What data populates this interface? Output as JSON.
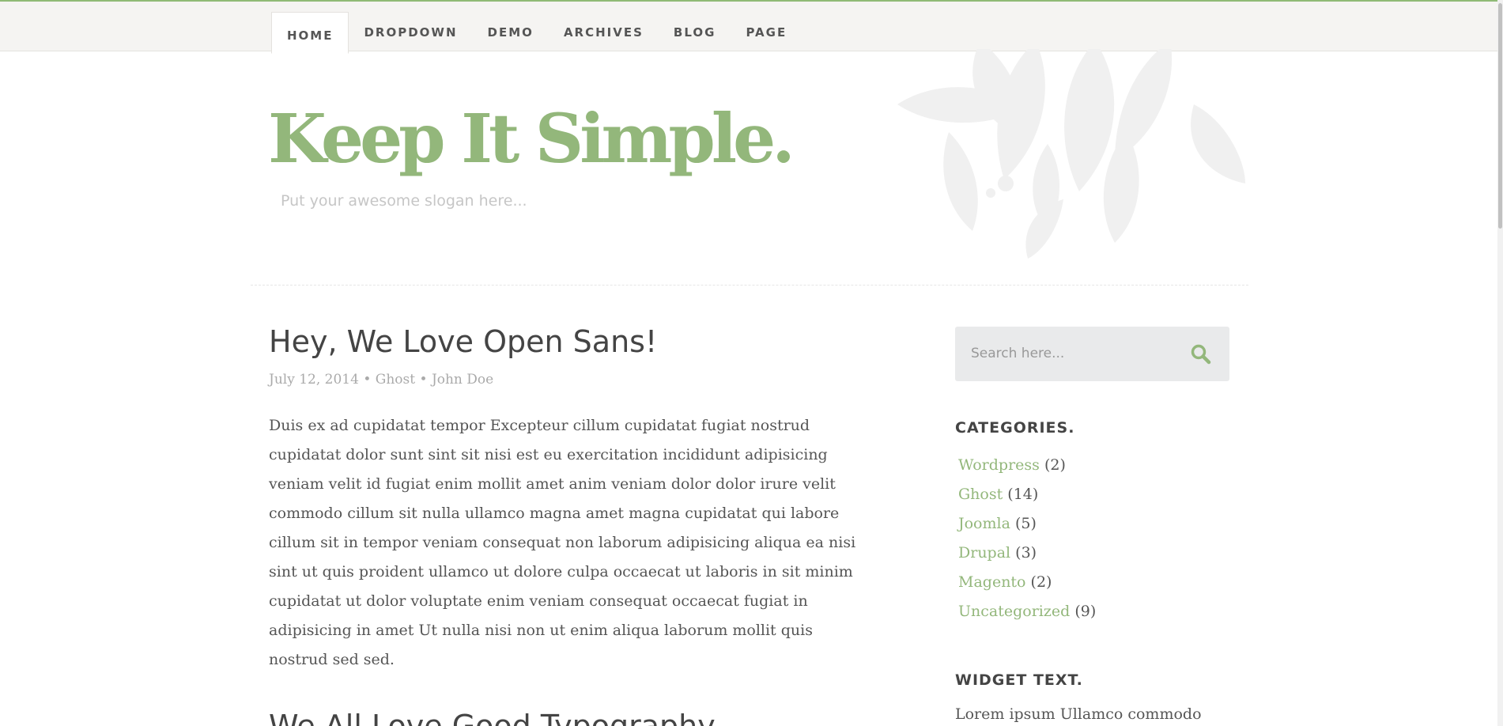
{
  "colors": {
    "accent": "#93b77b",
    "top_border": "#8fba76",
    "nav_bg": "#f5f4f2",
    "text": "#555555",
    "meta": "#aaaaaa",
    "decor": "#f0f0f0"
  },
  "nav": {
    "items": [
      {
        "label": "HOME",
        "active": true
      },
      {
        "label": "DROPDOWN"
      },
      {
        "label": "DEMO"
      },
      {
        "label": "ARCHIVES"
      },
      {
        "label": "BLOG"
      },
      {
        "label": "PAGE"
      }
    ]
  },
  "header": {
    "title": "Keep It Simple.",
    "slogan": "Put your awesome slogan here..."
  },
  "post": {
    "title": "Hey, We Love Open Sans!",
    "date": "July 12, 2014",
    "category": "Ghost",
    "author": "John Doe",
    "separator": "•",
    "body": "Duis ex ad cupidatat tempor Excepteur cillum cupidatat fugiat nostrud cupidatat dolor sunt sint sit nisi est eu exercitation incididunt adipisicing veniam velit id fugiat enim mollit amet anim veniam dolor dolor irure velit commodo cillum sit nulla ullamco magna amet magna cupidatat qui labore cillum sit in tempor veniam consequat non laborum adipisicing aliqua ea nisi sint ut quis proident ullamco ut dolore culpa occaecat ut laboris in sit minim cupidatat ut dolor voluptate enim veniam consequat occaecat fugiat in adipisicing in amet Ut nulla nisi non ut enim aliqua laborum mollit quis nostrud sed sed."
  },
  "post2": {
    "title": "We All Love Good Typography"
  },
  "sidebar": {
    "search": {
      "placeholder": "Search here...",
      "icon": "search-icon"
    },
    "categories": {
      "title": "CATEGORIES.",
      "items": [
        {
          "name": "Wordpress",
          "count": "(2)"
        },
        {
          "name": "Ghost",
          "count": "(14)"
        },
        {
          "name": "Joomla",
          "count": "(5)"
        },
        {
          "name": "Drupal",
          "count": "(3)"
        },
        {
          "name": "Magento",
          "count": "(2)"
        },
        {
          "name": "Uncategorized",
          "count": "(9)"
        }
      ]
    },
    "widget_text": {
      "title": "WIDGET TEXT.",
      "text": "Lorem ipsum Ullamco commodo"
    }
  }
}
